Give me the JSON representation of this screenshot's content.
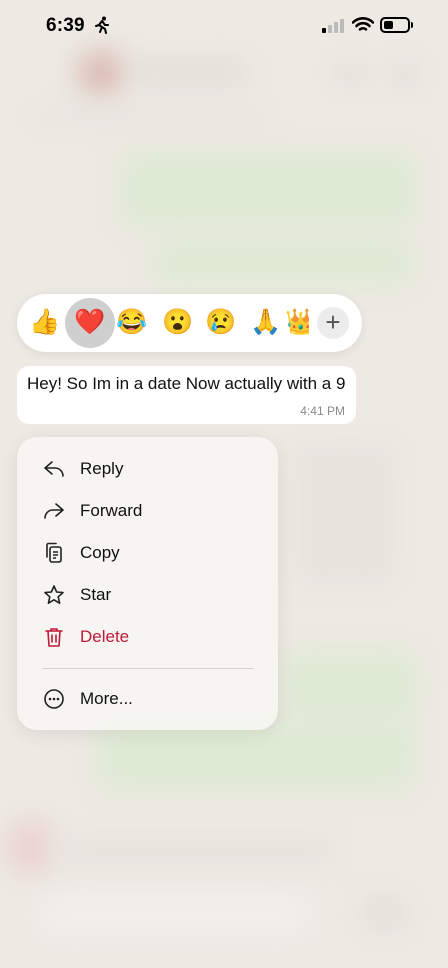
{
  "status_bar": {
    "time": "6:39"
  },
  "reactions": {
    "emojis": [
      "👍",
      "❤️",
      "😂",
      "😮",
      "😢",
      "🙏",
      "👑"
    ],
    "selected_index": 1,
    "add_label": "+"
  },
  "message": {
    "text": "Hey! So Im in a date Now actually with a 9",
    "time": "4:41 PM"
  },
  "menu": {
    "items": [
      {
        "label": "Reply",
        "icon": "reply-icon"
      },
      {
        "label": "Forward",
        "icon": "forward-icon"
      },
      {
        "label": "Copy",
        "icon": "copy-icon"
      },
      {
        "label": "Star",
        "icon": "star-icon"
      },
      {
        "label": "Delete",
        "icon": "trash-icon",
        "color": "#c0183a"
      },
      {
        "label": "More...",
        "icon": "more-icon"
      }
    ]
  }
}
